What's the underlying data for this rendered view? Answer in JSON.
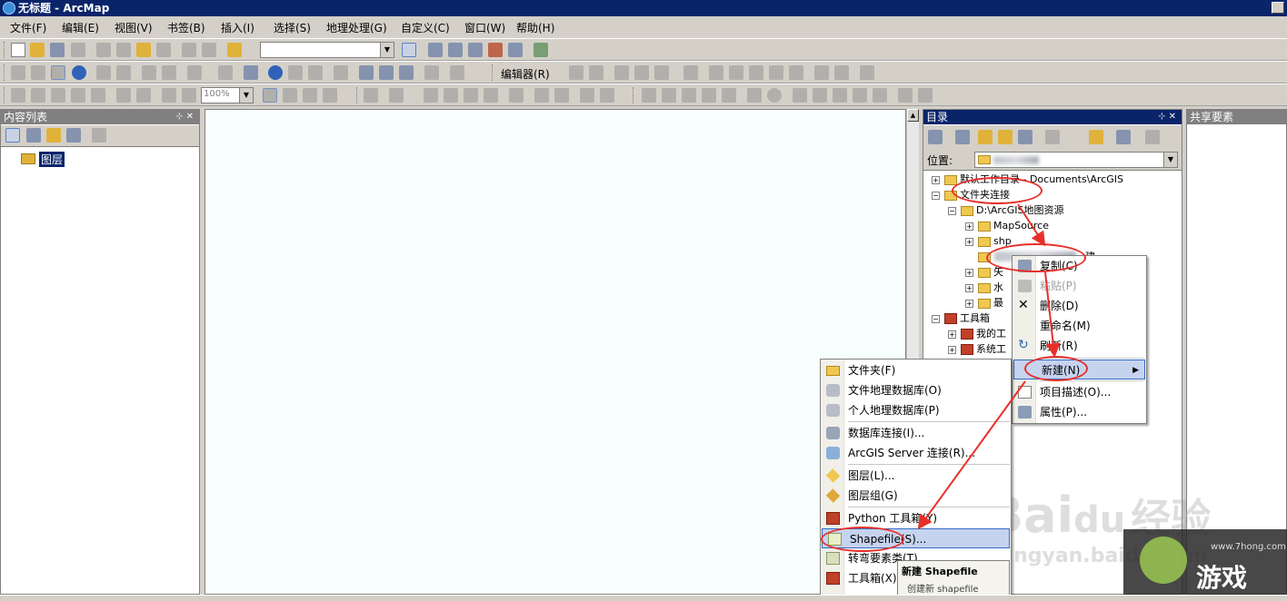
{
  "window": {
    "title": "无标题 - ArcMap"
  },
  "menu": [
    "文件(F)",
    "编辑(E)",
    "视图(V)",
    "书签(B)",
    "插入(I)",
    "选择(S)",
    "地理处理(G)",
    "自定义(C)",
    "窗口(W)",
    "帮助(H)"
  ],
  "toolbar": {
    "editor_label": "编辑器(R)",
    "zoom_value": "100%"
  },
  "toc": {
    "title": "内容列表",
    "layer_label": "图层"
  },
  "catalog": {
    "title": "目录",
    "location_label": "位置:",
    "tree": {
      "default_workdir": "默认工作目录 - Documents\\ArcGIS",
      "folder_connections": "文件夹连接",
      "d_path": "D:\\ArcGIS地图资源",
      "mapsource": "MapSource",
      "shp": "shp",
      "child_suffix": "建",
      "row5": "矢",
      "row6": "水",
      "row7": "最",
      "toolbox": "工具箱",
      "my_toolbox": "我的工",
      "system_toolbox": "系统工"
    }
  },
  "share": {
    "title": "共享要素"
  },
  "context_menu": {
    "copy": "复制(C)",
    "paste": "粘贴(P)",
    "delete": "删除(D)",
    "rename": "重命名(M)",
    "refresh": "刷新(R)",
    "new": "新建(N)",
    "item_desc": "项目描述(O)...",
    "properties": "属性(P)..."
  },
  "submenu": {
    "folder": "文件夹(F)",
    "file_gdb": "文件地理数据库(O)",
    "personal_gdb": "个人地理数据库(P)",
    "db_conn": "数据库连接(I)...",
    "ags_conn": "ArcGIS Server 连接(R)...",
    "layer": "图层(L)...",
    "group_layer": "图层组(G)",
    "python_tb": "Python 工具箱(Y)",
    "shapefile": "Shapefile(S)...",
    "turn_feature": "转弯要素类(T)...",
    "toolbox": "工具箱(X)"
  },
  "tooltip": {
    "title": "新建 Shapefile",
    "desc": "创建新 shapefile"
  },
  "watermark": {
    "brand": "Bai",
    "brand2": "du",
    "product": "经验",
    "url": "jingyan.baidu.com"
  },
  "logo": {
    "text": "游戏",
    "sub": "www.7hong.com"
  }
}
